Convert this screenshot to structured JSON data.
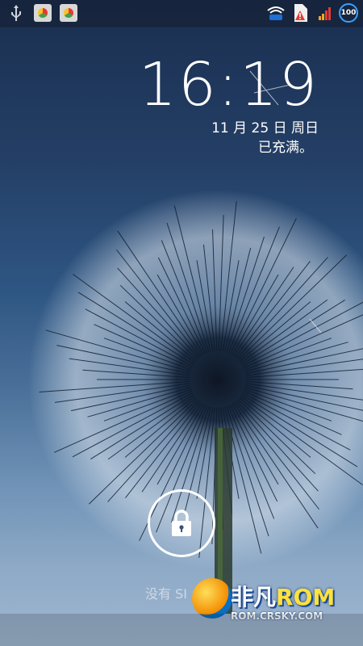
{
  "clock": {
    "time": "16:19"
  },
  "date": {
    "text": "11 月 25 日 周日"
  },
  "status": {
    "charging": "已充满。"
  },
  "statusbar": {
    "battery_level": "100",
    "left_icons": [
      "usb-icon",
      "app-notification-icon",
      "app-notification-icon"
    ],
    "right_icons": [
      "wifi-icon",
      "sim-warning-icon",
      "signal-icon",
      "battery-icon"
    ]
  },
  "lockscreen": {
    "hint_text": "没有 SI"
  },
  "watermark": {
    "brand_a": "非凡",
    "brand_b": "ROM",
    "site": "ROM.CRSKY.COM"
  },
  "colors": {
    "accent_blue": "#3ca0ff",
    "background_top": "#1a2f50",
    "background_bottom": "#9fb6cf"
  }
}
